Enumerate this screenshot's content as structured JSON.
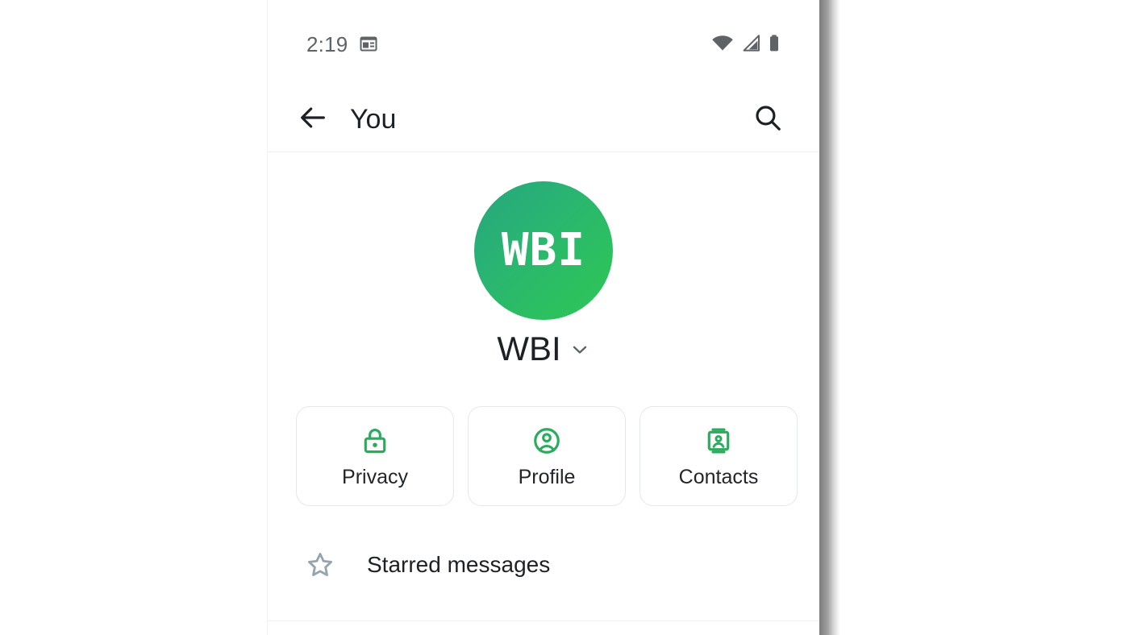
{
  "status_bar": {
    "time": "2:19",
    "left_icons": [
      "calendar-icon"
    ],
    "right_icons": [
      "wifi-icon",
      "cellular-signal-icon",
      "battery-icon"
    ]
  },
  "app_bar": {
    "back_icon": "back-arrow-icon",
    "title": "You",
    "search_icon": "search-icon"
  },
  "profile": {
    "avatar_initials": "WBI",
    "avatar_gradient_from": "#27a57c",
    "avatar_gradient_to": "#2ec75a",
    "display_name": "WBI",
    "expand_icon": "chevron-down-icon"
  },
  "quick_actions": [
    {
      "label": "Privacy",
      "icon": "lock-icon"
    },
    {
      "label": "Profile",
      "icon": "person-circle-icon"
    },
    {
      "label": "Contacts",
      "icon": "contact-card-icon"
    }
  ],
  "list_items": [
    {
      "label": "Starred messages",
      "icon": "star-outline-icon"
    }
  ],
  "colors": {
    "accent_green": "#2bab5e",
    "text_primary": "#1d2126",
    "text_secondary": "#5f6368",
    "icon_grey": "#8b9aa5",
    "card_border": "#e6e7e8",
    "divider": "#eef0f1"
  }
}
